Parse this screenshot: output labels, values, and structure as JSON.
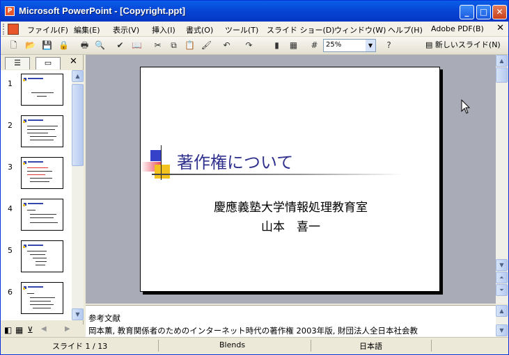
{
  "window": {
    "title": "Microsoft PowerPoint - [Copyright.ppt]",
    "app_icon": "powerpoint-icon"
  },
  "menu": [
    "ファイル(F)",
    "編集(E)",
    "表示(V)",
    "挿入(I)",
    "書式(O)",
    "ツール(T)",
    "スライド ショー(D)",
    "ウィンドウ(W)",
    "ヘルプ(H)",
    "Adobe PDF(B)"
  ],
  "toolbar": {
    "zoom_value": "25%",
    "new_slide_label": "新しいスライド(N)"
  },
  "thumbnails": [
    "1",
    "2",
    "3",
    "4",
    "5",
    "6"
  ],
  "slide": {
    "title": "著作権について",
    "subtitle1": "慶應義塾大学情報処理教育室",
    "subtitle2": "山本　喜一"
  },
  "notes": {
    "line1": "参考文献",
    "line2": "岡本薫, 教育関係者のためのインターネット時代の著作権 2003年版, 財団法人全日本社会教"
  },
  "status": {
    "slide": "スライド 1 / 13",
    "design": "Blends",
    "language": "日本語"
  },
  "colors": {
    "title_bar": "#0a5fe9",
    "slide_title": "#30308e",
    "accent_blue": "#3441c8",
    "accent_yellow": "#f4c21e",
    "accent_red": "#e6485a"
  }
}
